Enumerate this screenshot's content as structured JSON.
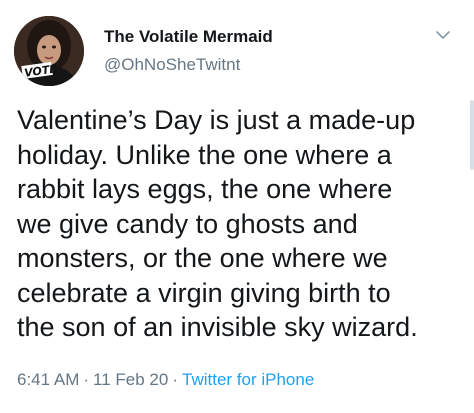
{
  "author": {
    "display_name": "The Volatile Mermaid",
    "handle": "@OhNoSheTwitnt",
    "avatar_badge": "VOTE"
  },
  "tweet": {
    "lines": [
      "Valentine’s Day is just a made-up",
      "holiday. Unlike the one where a",
      "rabbit lays eggs, the one where",
      "we give candy to ghosts and",
      "monsters, or the one where we",
      "celebrate a virgin giving birth to",
      "the son of an invisible sky wizard."
    ]
  },
  "meta": {
    "time": "6:41 AM",
    "separator": "·",
    "date": "11 Feb 20",
    "source": "Twitter for iPhone"
  },
  "icons": {
    "menu": "chevron-down-icon"
  },
  "colors": {
    "text": "#14171a",
    "secondary": "#657786",
    "link": "#1da1f2"
  }
}
